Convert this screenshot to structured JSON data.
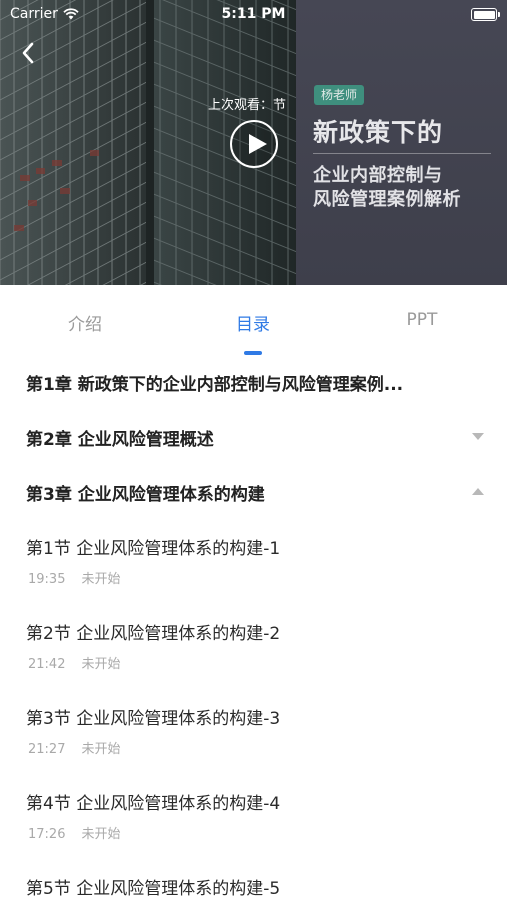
{
  "status_bar": {
    "carrier": "Carrier",
    "time": "5:11 PM"
  },
  "hero": {
    "last_watched": "上次观看：节",
    "teacher_tag": "杨老师",
    "cover_title": "新政策下的",
    "cover_subtitle_line1": "企业内部控制与",
    "cover_subtitle_line2": "风险管理案例解析"
  },
  "tabs": [
    {
      "label": "介绍",
      "active": false
    },
    {
      "label": "目录",
      "active": true
    },
    {
      "label": "PPT",
      "active": false
    }
  ],
  "chapters": [
    {
      "title": "第1章 新政策下的企业内部控制与风险管理案例...",
      "state": "none"
    },
    {
      "title": "第2章 企业风险管理概述",
      "state": "collapsed"
    },
    {
      "title": "第3章 企业风险管理体系的构建",
      "state": "expanded"
    }
  ],
  "sections": [
    {
      "title": "第1节 企业风险管理体系的构建-1",
      "duration": "19:35",
      "status": "未开始"
    },
    {
      "title": "第2节 企业风险管理体系的构建-2",
      "duration": "21:42",
      "status": "未开始"
    },
    {
      "title": "第3节 企业风险管理体系的构建-3",
      "duration": "21:27",
      "status": "未开始"
    },
    {
      "title": "第4节 企业风险管理体系的构建-4",
      "duration": "17:26",
      "status": "未开始"
    },
    {
      "title": "第5节 企业风险管理体系的构建-5",
      "duration": "",
      "status": ""
    }
  ],
  "colors": {
    "accent": "#2f7ae5",
    "muted_text": "#a9a9a9",
    "teacher_tag_bg": "#3f8f7e",
    "cover_panel_bg": "#434450"
  }
}
